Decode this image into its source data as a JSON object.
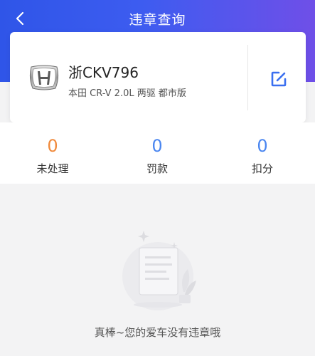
{
  "header": {
    "title": "违章查询",
    "back_icon": "chevron-left-icon",
    "gradient_start": "#2f55e8",
    "gradient_end": "#6f4fe8"
  },
  "car": {
    "logo_icon": "honda-logo",
    "plate": "浙CKV796",
    "model": "本田 CR-V 2.0L 两驱 都市版",
    "edit_icon": "edit-icon",
    "accent": "#3a6ff0"
  },
  "stats": [
    {
      "value": "0",
      "label": "未处理",
      "color": "#f08a3c"
    },
    {
      "value": "0",
      "label": "罚款",
      "color": "#4a86f0"
    },
    {
      "value": "0",
      "label": "扣分",
      "color": "#4a86f0"
    }
  ],
  "empty": {
    "illustration_icon": "empty-document-icon",
    "message": "真棒~您的爱车没有违章哦"
  }
}
